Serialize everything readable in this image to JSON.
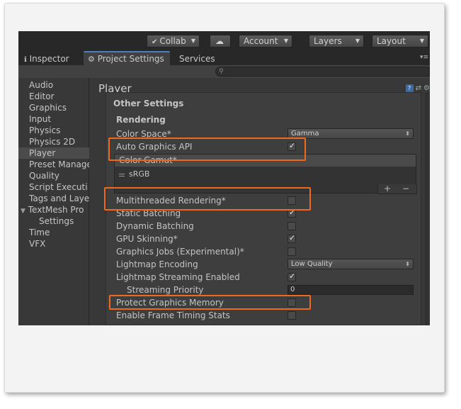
{
  "toolbar": {
    "collab_label": "Collab",
    "account_label": "Account",
    "layers_label": "Layers",
    "layout_label": "Layout"
  },
  "tabs": [
    {
      "label": "Inspector",
      "icon": "info-icon"
    },
    {
      "label": "Project Settings",
      "icon": "gear-icon"
    },
    {
      "label": "Services"
    }
  ],
  "sidebar": {
    "items": [
      {
        "label": "Audio"
      },
      {
        "label": "Editor"
      },
      {
        "label": "Graphics"
      },
      {
        "label": "Input"
      },
      {
        "label": "Physics"
      },
      {
        "label": "Physics 2D"
      },
      {
        "label": "Player"
      },
      {
        "label": "Preset Manage"
      },
      {
        "label": "Quality"
      },
      {
        "label": "Script Executi"
      },
      {
        "label": "Tags and Laye"
      },
      {
        "label": "TextMesh Pro"
      },
      {
        "label": "Settings"
      },
      {
        "label": "Time"
      },
      {
        "label": "VFX"
      }
    ],
    "selected": "Player"
  },
  "main": {
    "title": "Player",
    "section_header": "Other Settings",
    "rendering_header": "Rendering",
    "color_space": {
      "label": "Color Space*",
      "value": "Gamma"
    },
    "auto_graphics_api": {
      "label": "Auto Graphics API",
      "checked": true
    },
    "color_gamut": {
      "header": "Color Gamut*",
      "items": [
        "sRGB"
      ],
      "add": "+",
      "remove": "−"
    },
    "multithreaded_rendering": {
      "label": "Multithreaded Rendering*",
      "checked": false
    },
    "static_batching": {
      "label": "Static Batching",
      "checked": true
    },
    "dynamic_batching": {
      "label": "Dynamic Batching",
      "checked": false
    },
    "gpu_skinning": {
      "label": "GPU Skinning*",
      "checked": true
    },
    "graphics_jobs": {
      "label": "Graphics Jobs (Experimental)*",
      "checked": false
    },
    "lightmap_encoding": {
      "label": "Lightmap Encoding",
      "value": "Low Quality"
    },
    "lightmap_streaming": {
      "label": "Lightmap Streaming Enabled",
      "checked": true
    },
    "streaming_priority": {
      "label": "Streaming Priority",
      "value": "0"
    },
    "protect_graphics_memory": {
      "label": "Protect Graphics Memory",
      "checked": false
    },
    "frame_timing_stats": {
      "label": "Enable Frame Timing Stats",
      "checked": false
    }
  },
  "colors": {
    "highlight": "#ef6a1e",
    "tab_accent": "#4a7fc1",
    "background": "#383838"
  }
}
